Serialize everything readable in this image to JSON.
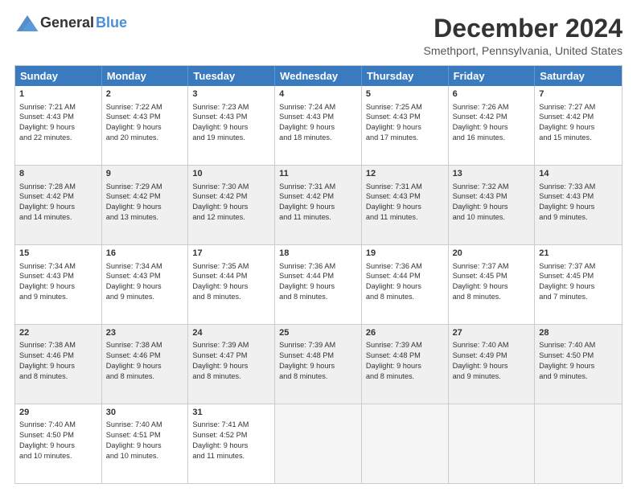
{
  "logo": {
    "general": "General",
    "blue": "Blue"
  },
  "title": "December 2024",
  "subtitle": "Smethport, Pennsylvania, United States",
  "header_days": [
    "Sunday",
    "Monday",
    "Tuesday",
    "Wednesday",
    "Thursday",
    "Friday",
    "Saturday"
  ],
  "weeks": [
    [
      {
        "day": "1",
        "lines": [
          "Sunrise: 7:21 AM",
          "Sunset: 4:43 PM",
          "Daylight: 9 hours",
          "and 22 minutes."
        ]
      },
      {
        "day": "2",
        "lines": [
          "Sunrise: 7:22 AM",
          "Sunset: 4:43 PM",
          "Daylight: 9 hours",
          "and 20 minutes."
        ]
      },
      {
        "day": "3",
        "lines": [
          "Sunrise: 7:23 AM",
          "Sunset: 4:43 PM",
          "Daylight: 9 hours",
          "and 19 minutes."
        ]
      },
      {
        "day": "4",
        "lines": [
          "Sunrise: 7:24 AM",
          "Sunset: 4:43 PM",
          "Daylight: 9 hours",
          "and 18 minutes."
        ]
      },
      {
        "day": "5",
        "lines": [
          "Sunrise: 7:25 AM",
          "Sunset: 4:43 PM",
          "Daylight: 9 hours",
          "and 17 minutes."
        ]
      },
      {
        "day": "6",
        "lines": [
          "Sunrise: 7:26 AM",
          "Sunset: 4:42 PM",
          "Daylight: 9 hours",
          "and 16 minutes."
        ]
      },
      {
        "day": "7",
        "lines": [
          "Sunrise: 7:27 AM",
          "Sunset: 4:42 PM",
          "Daylight: 9 hours",
          "and 15 minutes."
        ]
      }
    ],
    [
      {
        "day": "8",
        "lines": [
          "Sunrise: 7:28 AM",
          "Sunset: 4:42 PM",
          "Daylight: 9 hours",
          "and 14 minutes."
        ]
      },
      {
        "day": "9",
        "lines": [
          "Sunrise: 7:29 AM",
          "Sunset: 4:42 PM",
          "Daylight: 9 hours",
          "and 13 minutes."
        ]
      },
      {
        "day": "10",
        "lines": [
          "Sunrise: 7:30 AM",
          "Sunset: 4:42 PM",
          "Daylight: 9 hours",
          "and 12 minutes."
        ]
      },
      {
        "day": "11",
        "lines": [
          "Sunrise: 7:31 AM",
          "Sunset: 4:42 PM",
          "Daylight: 9 hours",
          "and 11 minutes."
        ]
      },
      {
        "day": "12",
        "lines": [
          "Sunrise: 7:31 AM",
          "Sunset: 4:43 PM",
          "Daylight: 9 hours",
          "and 11 minutes."
        ]
      },
      {
        "day": "13",
        "lines": [
          "Sunrise: 7:32 AM",
          "Sunset: 4:43 PM",
          "Daylight: 9 hours",
          "and 10 minutes."
        ]
      },
      {
        "day": "14",
        "lines": [
          "Sunrise: 7:33 AM",
          "Sunset: 4:43 PM",
          "Daylight: 9 hours",
          "and 9 minutes."
        ]
      }
    ],
    [
      {
        "day": "15",
        "lines": [
          "Sunrise: 7:34 AM",
          "Sunset: 4:43 PM",
          "Daylight: 9 hours",
          "and 9 minutes."
        ]
      },
      {
        "day": "16",
        "lines": [
          "Sunrise: 7:34 AM",
          "Sunset: 4:43 PM",
          "Daylight: 9 hours",
          "and 9 minutes."
        ]
      },
      {
        "day": "17",
        "lines": [
          "Sunrise: 7:35 AM",
          "Sunset: 4:44 PM",
          "Daylight: 9 hours",
          "and 8 minutes."
        ]
      },
      {
        "day": "18",
        "lines": [
          "Sunrise: 7:36 AM",
          "Sunset: 4:44 PM",
          "Daylight: 9 hours",
          "and 8 minutes."
        ]
      },
      {
        "day": "19",
        "lines": [
          "Sunrise: 7:36 AM",
          "Sunset: 4:44 PM",
          "Daylight: 9 hours",
          "and 8 minutes."
        ]
      },
      {
        "day": "20",
        "lines": [
          "Sunrise: 7:37 AM",
          "Sunset: 4:45 PM",
          "Daylight: 9 hours",
          "and 8 minutes."
        ]
      },
      {
        "day": "21",
        "lines": [
          "Sunrise: 7:37 AM",
          "Sunset: 4:45 PM",
          "Daylight: 9 hours",
          "and 7 minutes."
        ]
      }
    ],
    [
      {
        "day": "22",
        "lines": [
          "Sunrise: 7:38 AM",
          "Sunset: 4:46 PM",
          "Daylight: 9 hours",
          "and 8 minutes."
        ]
      },
      {
        "day": "23",
        "lines": [
          "Sunrise: 7:38 AM",
          "Sunset: 4:46 PM",
          "Daylight: 9 hours",
          "and 8 minutes."
        ]
      },
      {
        "day": "24",
        "lines": [
          "Sunrise: 7:39 AM",
          "Sunset: 4:47 PM",
          "Daylight: 9 hours",
          "and 8 minutes."
        ]
      },
      {
        "day": "25",
        "lines": [
          "Sunrise: 7:39 AM",
          "Sunset: 4:48 PM",
          "Daylight: 9 hours",
          "and 8 minutes."
        ]
      },
      {
        "day": "26",
        "lines": [
          "Sunrise: 7:39 AM",
          "Sunset: 4:48 PM",
          "Daylight: 9 hours",
          "and 8 minutes."
        ]
      },
      {
        "day": "27",
        "lines": [
          "Sunrise: 7:40 AM",
          "Sunset: 4:49 PM",
          "Daylight: 9 hours",
          "and 9 minutes."
        ]
      },
      {
        "day": "28",
        "lines": [
          "Sunrise: 7:40 AM",
          "Sunset: 4:50 PM",
          "Daylight: 9 hours",
          "and 9 minutes."
        ]
      }
    ],
    [
      {
        "day": "29",
        "lines": [
          "Sunrise: 7:40 AM",
          "Sunset: 4:50 PM",
          "Daylight: 9 hours",
          "and 10 minutes."
        ]
      },
      {
        "day": "30",
        "lines": [
          "Sunrise: 7:40 AM",
          "Sunset: 4:51 PM",
          "Daylight: 9 hours",
          "and 10 minutes."
        ]
      },
      {
        "day": "31",
        "lines": [
          "Sunrise: 7:41 AM",
          "Sunset: 4:52 PM",
          "Daylight: 9 hours",
          "and 11 minutes."
        ]
      },
      {
        "day": "",
        "lines": []
      },
      {
        "day": "",
        "lines": []
      },
      {
        "day": "",
        "lines": []
      },
      {
        "day": "",
        "lines": []
      }
    ]
  ]
}
